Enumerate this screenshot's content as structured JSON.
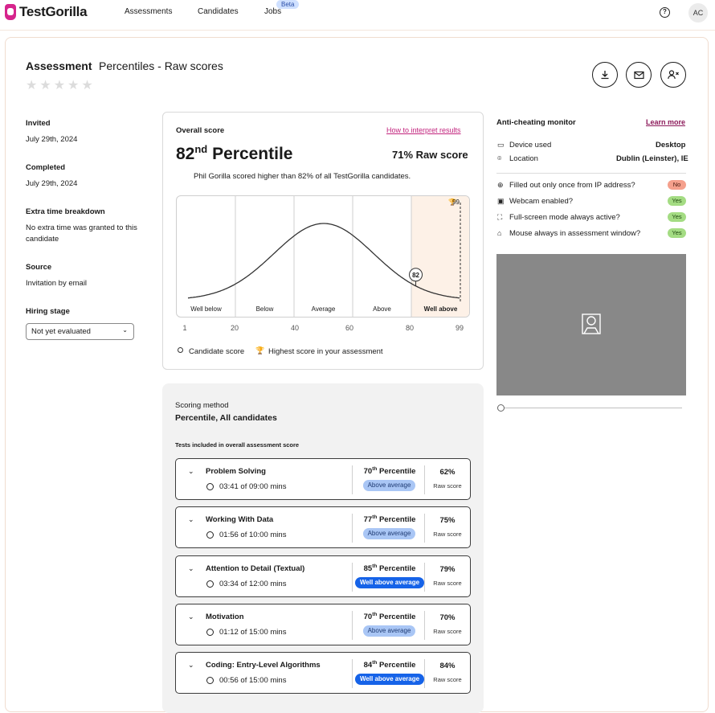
{
  "brand": {
    "name": "TestGorilla",
    "accent": "#d6248c"
  },
  "nav": {
    "assessments": "Assessments",
    "candidates": "Candidates",
    "jobs": "Jobs",
    "beta": "Beta"
  },
  "user": {
    "initials": "AC"
  },
  "header": {
    "title": "Assessment",
    "subtitle": "Percentiles - Raw scores"
  },
  "info": {
    "invited_label": "Invited",
    "invited_value": "July 29th, 2024",
    "completed_label": "Completed",
    "completed_value": "July 29th, 2024",
    "extra_label": "Extra time breakdown",
    "extra_value": "No extra time was granted to this candidate",
    "source_label": "Source",
    "source_value": "Invitation by email",
    "stage_label": "Hiring stage",
    "stage_value": "Not yet evaluated"
  },
  "overall": {
    "title": "Overall score",
    "link": "How to interpret results",
    "percentile_num": "82",
    "percentile_sup": "nd",
    "percentile_word": "Percentile",
    "raw": "71% Raw score",
    "summary": "Phil Gorilla scored higher than 82% of all TestGorilla candidates.",
    "candidate_score": 82,
    "highest_score": 99,
    "bands": [
      "Well below",
      "Below",
      "Average",
      "Above",
      "Well above"
    ],
    "ticks": [
      "1",
      "20",
      "40",
      "60",
      "80",
      "99"
    ],
    "legend_candidate": "Candidate score",
    "legend_highest": "Highest score in your assessment"
  },
  "scoring": {
    "method_label": "Scoring method",
    "method_value": "Percentile, All candidates",
    "tests_label": "Tests included in overall assessment score",
    "tests": [
      {
        "name": "Problem Solving",
        "time": "03:41 of 09:00 mins",
        "pct": "70",
        "sup": "th",
        "pword": "Percentile",
        "badge": "Above average",
        "raw": "62%",
        "rawlbl": "Raw score"
      },
      {
        "name": "Working With Data",
        "time": "01:56 of 10:00 mins",
        "pct": "77",
        "sup": "th",
        "pword": "Percentile",
        "badge": "Above average",
        "raw": "75%",
        "rawlbl": "Raw score"
      },
      {
        "name": "Attention to Detail (Textual)",
        "time": "03:34 of 12:00 mins",
        "pct": "85",
        "sup": "th",
        "pword": "Percentile",
        "badge": "Well above average",
        "raw": "79%",
        "rawlbl": "Raw score"
      },
      {
        "name": "Motivation",
        "time": "01:12 of 15:00 mins",
        "pct": "70",
        "sup": "th",
        "pword": "Percentile",
        "badge": "Above average",
        "raw": "70%",
        "rawlbl": "Raw score"
      },
      {
        "name": "Coding: Entry-Level Algorithms",
        "time": "00:56 of 15:00 mins",
        "pct": "84",
        "sup": "th",
        "pword": "Percentile",
        "badge": "Well above average",
        "raw": "84%",
        "rawlbl": "Raw score"
      }
    ]
  },
  "monitor": {
    "title": "Anti-cheating monitor",
    "learn": "Learn more",
    "device_label": "Device used",
    "device_value": "Desktop",
    "location_label": "Location",
    "location_value": "Dublin (Leinster), IE",
    "checks": [
      {
        "label": "Filled out only once from IP address?",
        "value": "No"
      },
      {
        "label": "Webcam enabled?",
        "value": "Yes"
      },
      {
        "label": "Full-screen mode always active?",
        "value": "Yes"
      },
      {
        "label": "Mouse always in assessment window?",
        "value": "Yes"
      }
    ]
  }
}
